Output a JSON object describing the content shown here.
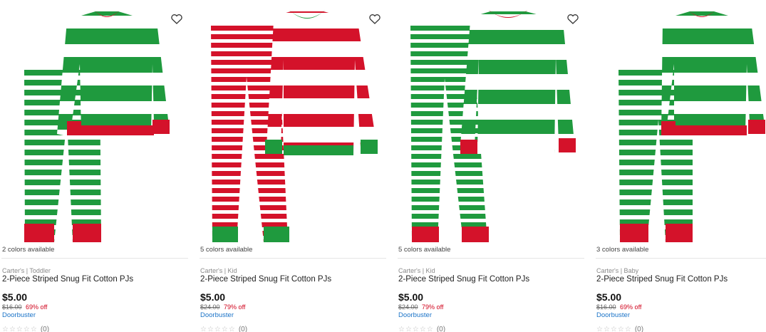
{
  "colors": {
    "green": "#1f9a3e",
    "red": "#d4122a",
    "white": "#ffffff",
    "price": "#111111",
    "discount": "#d0021b",
    "promo": "#1a73c8"
  },
  "icons": {
    "wishlist": "heart-outline-icon",
    "rating": "star-icon"
  },
  "products": [
    {
      "colors_available": "2 colors available",
      "brand_line": "Carter's | Toddler",
      "title": "2-Piece Striped Snug Fit Cotton PJs",
      "price": "$5.00",
      "original_price": "$16.00",
      "discount": "69% off",
      "promo": "Doorbuster",
      "rating_stars": "☆☆☆☆☆",
      "rating_count": "(0)"
    },
    {
      "colors_available": "5 colors available",
      "brand_line": "Carter's | Kid",
      "title": "2-Piece Striped Snug Fit Cotton PJs",
      "price": "$5.00",
      "original_price": "$24.00",
      "discount": "79% off",
      "promo": "Doorbuster",
      "rating_stars": "☆☆☆☆☆",
      "rating_count": "(0)"
    },
    {
      "colors_available": "5 colors available",
      "brand_line": "Carter's | Kid",
      "title": "2-Piece Striped Snug Fit Cotton PJs",
      "price": "$5.00",
      "original_price": "$24.00",
      "discount": "79% off",
      "promo": "Doorbuster",
      "rating_stars": "☆☆☆☆☆",
      "rating_count": "(0)"
    },
    {
      "colors_available": "3 colors available",
      "brand_line": "Carter's | Baby",
      "title": "2-Piece Striped Snug Fit Cotton PJs",
      "price": "$5.00",
      "original_price": "$16.00",
      "discount": "69% off",
      "promo": "Doorbuster",
      "rating_stars": "☆☆☆☆☆",
      "rating_count": "(0)"
    }
  ]
}
